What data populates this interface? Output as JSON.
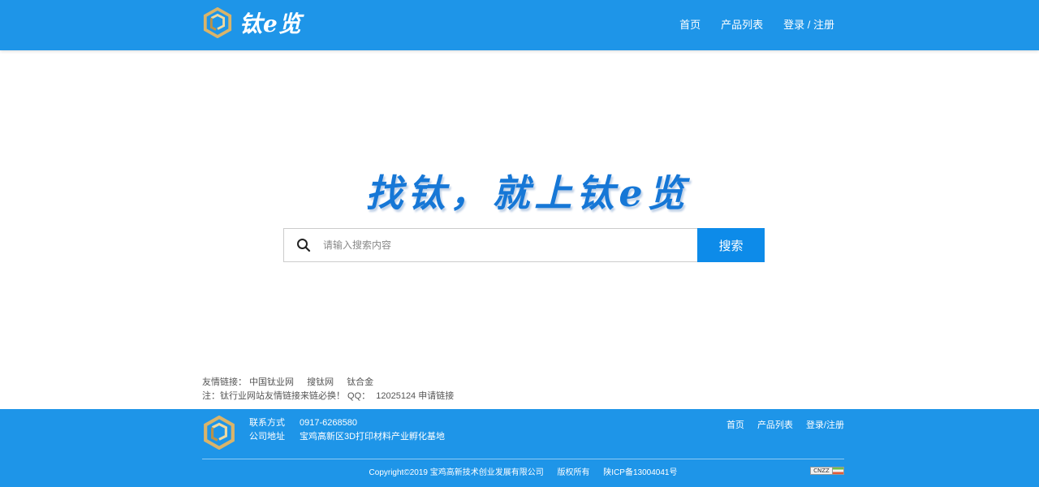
{
  "header": {
    "logo_text": "钛e览",
    "nav": [
      {
        "label": "首页"
      },
      {
        "label": "产品列表"
      },
      {
        "label": "登录 / 注册"
      }
    ]
  },
  "hero": {
    "slogan": "找钛，就上钛e览"
  },
  "search": {
    "placeholder": "请输入搜索内容",
    "value": "",
    "button_label": "搜索",
    "icon": "search-icon"
  },
  "friend_links": {
    "label": "友情链接：",
    "items": [
      "中国钛业网",
      "搜钛网",
      "钛合金"
    ],
    "note": "注：钛行业网站友情链接来链必换！ QQ：",
    "qq": "12025124",
    "apply_label": "申请链接"
  },
  "footer": {
    "contact_label": "联系方式",
    "contact_value": "0917-6268580",
    "address_label": "公司地址",
    "address_value": "宝鸡高新区3D打印材料产业孵化基地",
    "nav": [
      {
        "label": "首页"
      },
      {
        "label": "产品列表"
      },
      {
        "label": "登录/注册"
      }
    ],
    "copyright": "Copyright©2019 宝鸡高新技术创业发展有限公司",
    "rights": "版权所有",
    "icp": "陕ICP备13004041号",
    "badge": "CNZZ"
  },
  "colors": {
    "brand_blue": "#1e95e8",
    "button_blue": "#0d8be9",
    "slogan_blue": "#1677d6",
    "logo_gold": "#d9b46a"
  }
}
